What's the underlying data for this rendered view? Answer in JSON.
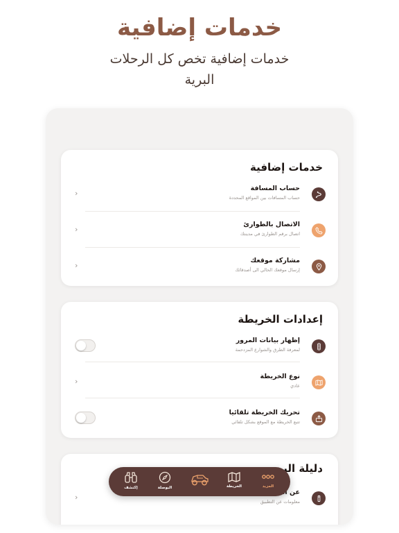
{
  "hero": {
    "title": "خدمات إضافية",
    "subtitle": "خدمات إضافية تخص كل الرحلات البرية"
  },
  "sections": [
    {
      "title": "خدمات إضافية",
      "items": [
        {
          "title": "حساب المسافة",
          "subtitle": "حساب المسافات بين المواقع المحددة",
          "icon": "route-icon",
          "control": "chevron"
        },
        {
          "title": "الاتصال بالطوارئ",
          "subtitle": "اتصال برقم الطوارئ في مدينتك",
          "icon": "phone-icon",
          "control": "chevron"
        },
        {
          "title": "مشاركة موقعك",
          "subtitle": "إرسال موقعك الحالي الى أصدقائك",
          "icon": "location-pin-icon",
          "control": "chevron"
        }
      ]
    },
    {
      "title": "إعدادات الخريطة",
      "items": [
        {
          "title": "إظهار بيانات المرور",
          "subtitle": "لمعرفة الطرق والشوارع المزدحمة",
          "icon": "traffic-light-icon",
          "control": "toggle",
          "on": false
        },
        {
          "title": "نوع الخريطة",
          "subtitle": "عادي",
          "icon": "map-icon",
          "control": "chevron"
        },
        {
          "title": "تحريك الخريطة تلقائيا",
          "subtitle": "تتبع الخريطة مع الموقع بشكل تلقائي",
          "icon": "move-map-icon",
          "control": "toggle",
          "on": false
        }
      ]
    },
    {
      "title": "دليلة البر",
      "items": [
        {
          "title": "عن التطبيق",
          "subtitle": "معلومات عن التطبيق",
          "icon": "info-icon",
          "control": "chevron"
        }
      ]
    }
  ],
  "chevron_glyph": "‹",
  "nav": {
    "items": [
      {
        "label": "المزيد",
        "icon": "more-dots-icon",
        "active": true
      },
      {
        "label": "الخريطة",
        "icon": "map-icon",
        "active": false
      },
      {
        "label": "",
        "icon": "offroad-car-icon",
        "active": false
      },
      {
        "label": "البوصلة",
        "icon": "compass-icon",
        "active": false
      },
      {
        "label": "إكتشف",
        "icon": "binoculars-icon",
        "active": false
      }
    ]
  },
  "colors": {
    "brand": "#8c5a45",
    "accent": "#eea36d",
    "dark": "#5b3b37"
  }
}
